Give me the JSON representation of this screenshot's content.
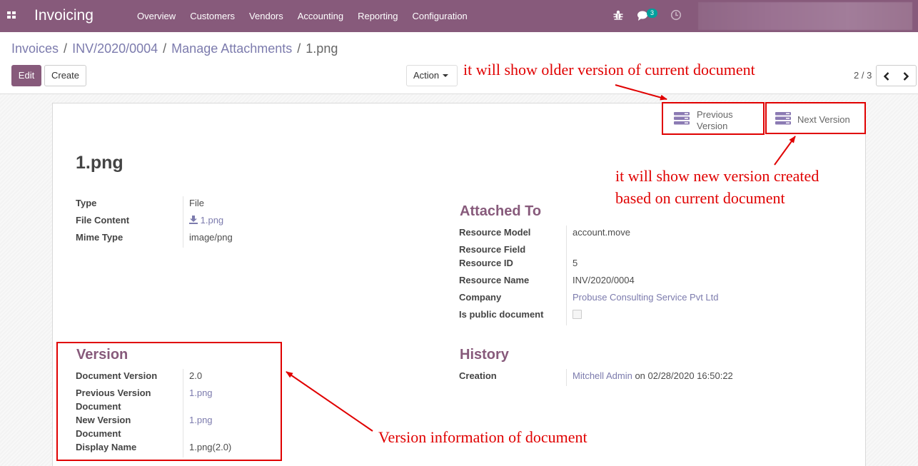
{
  "navbar": {
    "app_title": "Invoicing",
    "menu": [
      "Overview",
      "Customers",
      "Vendors",
      "Accounting",
      "Reporting",
      "Configuration"
    ],
    "message_count": "3",
    "icons": [
      "apps-icon",
      "bug-icon",
      "chat-icon",
      "clock-icon"
    ],
    "accent_color": "#875a7b"
  },
  "breadcrumb": {
    "items": [
      "Invoices",
      "INV/2020/0004",
      "Manage Attachments"
    ],
    "separator": "/",
    "current": "1.png"
  },
  "buttons": {
    "edit": "Edit",
    "create": "Create",
    "action": "Action"
  },
  "pager": {
    "value": "2 / 3"
  },
  "stat_buttons": {
    "previous": "Previous Version",
    "next": "Next Version",
    "icon": "server-icon"
  },
  "record": {
    "title": "1.png",
    "left_fields": [
      {
        "label": "Type",
        "value": "File"
      },
      {
        "label": "File Content",
        "value": "1.png"
      },
      {
        "label": "Mime Type",
        "value": "image/png"
      }
    ],
    "attached_to": {
      "title": "Attached To",
      "fields": [
        {
          "label": "Resource Model",
          "value": "account.move"
        },
        {
          "label": "Resource Field",
          "value": ""
        },
        {
          "label": "Resource ID",
          "value": "5"
        },
        {
          "label": "Resource Name",
          "value": "INV/2020/0004"
        },
        {
          "label": "Company",
          "value": "Probuse Consulting Service Pvt Ltd"
        },
        {
          "label": "Is public document",
          "value": false
        }
      ]
    },
    "version": {
      "title": "Version",
      "fields": [
        {
          "label": "Document Version",
          "value": "2.0"
        },
        {
          "label": "Previous Version Document",
          "value": "1.png"
        },
        {
          "label": "New Version Document",
          "value": "1.png"
        },
        {
          "label": "Display Name",
          "value": "1.png(2.0)"
        }
      ]
    },
    "history": {
      "title": "History",
      "creation_label": "Creation",
      "creation_user": "Mitchell Admin",
      "creation_on": "on 02/28/2020 16:50:22"
    }
  },
  "annotations": {
    "older": "it will show older version of current document",
    "newer_line1": "it will show new version created",
    "newer_line2": "based on current document",
    "version_info": "Version information of document",
    "color": "#e00000"
  }
}
